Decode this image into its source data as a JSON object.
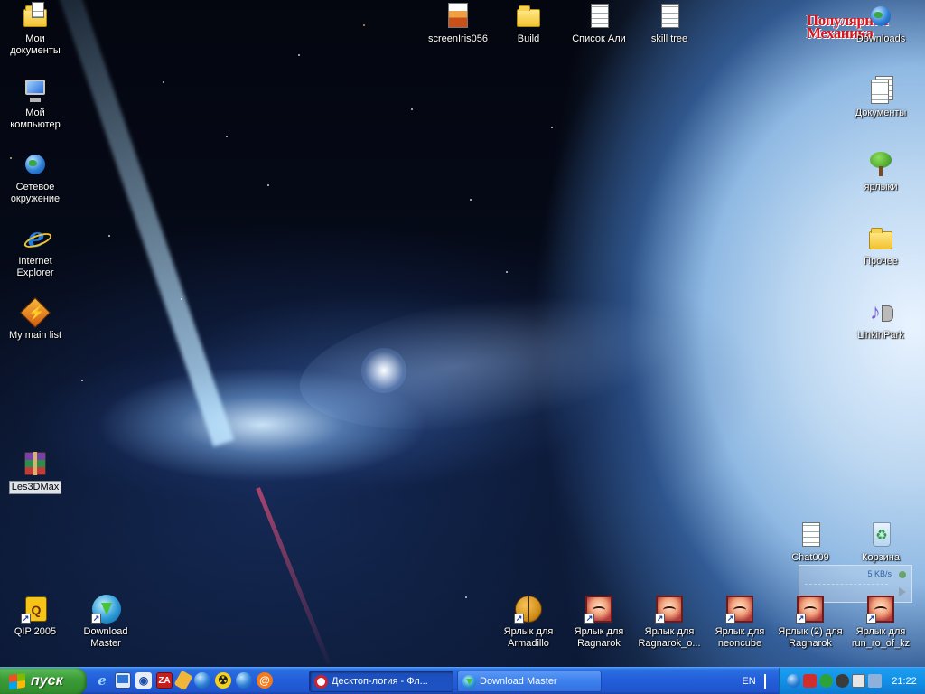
{
  "desktop": {
    "logo_text": "Популярная Механика",
    "icons_left": [
      {
        "label": "Мои документы",
        "icon": "my-documents-icon"
      },
      {
        "label": "Мой компьютер",
        "icon": "my-computer-icon"
      },
      {
        "label": "Сетевое окружение",
        "icon": "network-places-icon"
      },
      {
        "label": "Internet Explorer",
        "icon": "internet-explorer-icon"
      },
      {
        "label": "My main list",
        "icon": "winamp-playlist-icon"
      },
      {
        "label": "Les3DMax",
        "icon": "winrar-archive-icon"
      },
      {
        "label": "QIP 2005",
        "icon": "qip-icon"
      },
      {
        "label": "Download Master",
        "icon": "download-master-icon"
      }
    ],
    "icons_top": [
      {
        "label": "screenIris056",
        "icon": "image-file-icon"
      },
      {
        "label": "Build",
        "icon": "folder-icon"
      },
      {
        "label": "Список Али",
        "icon": "text-document-icon"
      },
      {
        "label": "skill tree",
        "icon": "text-document-icon"
      }
    ],
    "icons_right": [
      {
        "label": "Downloads",
        "icon": "downloads-globe-icon"
      },
      {
        "label": "Документы",
        "icon": "documents-icon"
      },
      {
        "label": "ярлыки",
        "icon": "tree-icon"
      },
      {
        "label": "Прочее",
        "icon": "folder-icon"
      },
      {
        "label": "LinkinPark",
        "icon": "music-icon"
      },
      {
        "label": "Chat009",
        "icon": "text-document-icon"
      },
      {
        "label": "Корзина",
        "icon": "recycle-bin-icon"
      }
    ],
    "icons_bottom": [
      {
        "label": "Ярлык для Armadillo",
        "icon": "armadillo-ball-icon"
      },
      {
        "label": "Ярлык для Ragnarok",
        "icon": "ragnarok-icon"
      },
      {
        "label": "Ярлык для Ragnarok_o...",
        "icon": "ragnarok-icon"
      },
      {
        "label": "Ярлык для neoncube",
        "icon": "ragnarok-icon"
      },
      {
        "label": "Ярлык (2) для Ragnarok",
        "icon": "ragnarok-icon"
      },
      {
        "label": "Ярлык для run_ro_of_kz",
        "icon": "ragnarok-icon"
      }
    ],
    "net_meter": {
      "speed": "5 KB/s"
    }
  },
  "taskbar": {
    "start_label": "пуск",
    "quick_launch": [
      "internet-explorer-icon",
      "show-desktop-icon",
      "disk-icon",
      "zonealarm-icon",
      "tag-icon",
      "globe-icon",
      "radiation-icon",
      "globe-icon",
      "mail-at-icon"
    ],
    "tasks": [
      {
        "label": "Десктоп-логия - Фл...",
        "icon": "opera-icon",
        "active": true
      },
      {
        "label": "Download Master",
        "icon": "download-master-icon",
        "active": false
      }
    ],
    "language": "EN",
    "tray_icons": [
      "globe-tray-icon",
      "shield-tray-icon",
      "eye-tray-icon",
      "spider-tray-icon",
      "settings-tray-icon",
      "network-tray-icon"
    ],
    "clock": "21:22"
  },
  "colors": {
    "taskbar_blue": "#245edb",
    "start_green": "#3c9d38",
    "tray_blue": "#1290e6",
    "logo_red": "#d9151e"
  }
}
